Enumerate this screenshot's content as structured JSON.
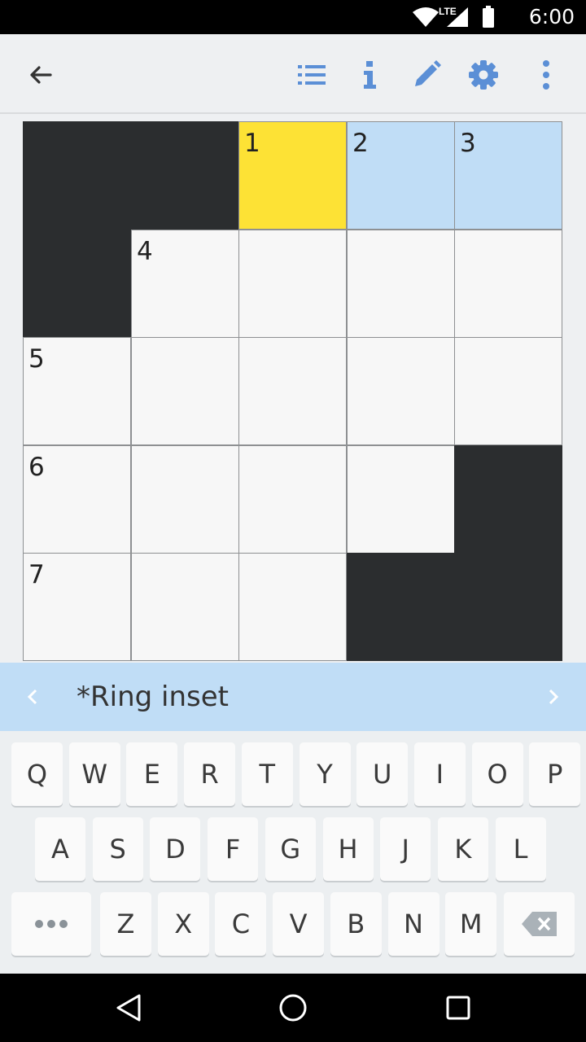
{
  "status_bar": {
    "time": "6:00",
    "network_label": "LTE",
    "icons": [
      "wifi-icon",
      "cell-signal-icon",
      "battery-icon"
    ]
  },
  "toolbar": {
    "icons": [
      "back-arrow-icon",
      "clue-list-icon",
      "info-icon",
      "pencil-icon",
      "settings-gear-icon",
      "more-vert-icon"
    ],
    "accent_color": "#5b8fd6"
  },
  "grid": {
    "size": 5,
    "rows": [
      [
        {
          "type": "black"
        },
        {
          "type": "black"
        },
        {
          "type": "active",
          "number": "1"
        },
        {
          "type": "word",
          "number": "2"
        },
        {
          "type": "word",
          "number": "3"
        }
      ],
      [
        {
          "type": "black"
        },
        {
          "type": "open",
          "number": "4"
        },
        {
          "type": "open"
        },
        {
          "type": "open"
        },
        {
          "type": "open"
        }
      ],
      [
        {
          "type": "open",
          "number": "5"
        },
        {
          "type": "open"
        },
        {
          "type": "open"
        },
        {
          "type": "open"
        },
        {
          "type": "open"
        }
      ],
      [
        {
          "type": "open",
          "number": "6"
        },
        {
          "type": "open"
        },
        {
          "type": "open"
        },
        {
          "type": "open"
        },
        {
          "type": "black"
        }
      ],
      [
        {
          "type": "open",
          "number": "7"
        },
        {
          "type": "open"
        },
        {
          "type": "open"
        },
        {
          "type": "black"
        },
        {
          "type": "black"
        }
      ]
    ],
    "colors": {
      "black_cell": "#2b2d2f",
      "active_cell": "#fde235",
      "word_highlight": "#c0ddf6",
      "open_cell": "#f7f7f7"
    }
  },
  "clue_bar": {
    "clue_text": "*Ring inset",
    "prev_icon": "chevron-left-icon",
    "next_icon": "chevron-right-icon",
    "background": "#c0ddf6"
  },
  "keyboard": {
    "row1": [
      "Q",
      "W",
      "E",
      "R",
      "T",
      "Y",
      "U",
      "I",
      "O",
      "P"
    ],
    "row2": [
      "A",
      "S",
      "D",
      "F",
      "G",
      "H",
      "J",
      "K",
      "L"
    ],
    "row3": [
      "Z",
      "X",
      "C",
      "V",
      "B",
      "N",
      "M"
    ],
    "more_key_icon": "more-dots-icon",
    "backspace_icon": "backspace-icon"
  },
  "nav_bar": {
    "icons": [
      "back-triangle-icon",
      "home-circle-icon",
      "recents-square-icon"
    ]
  }
}
